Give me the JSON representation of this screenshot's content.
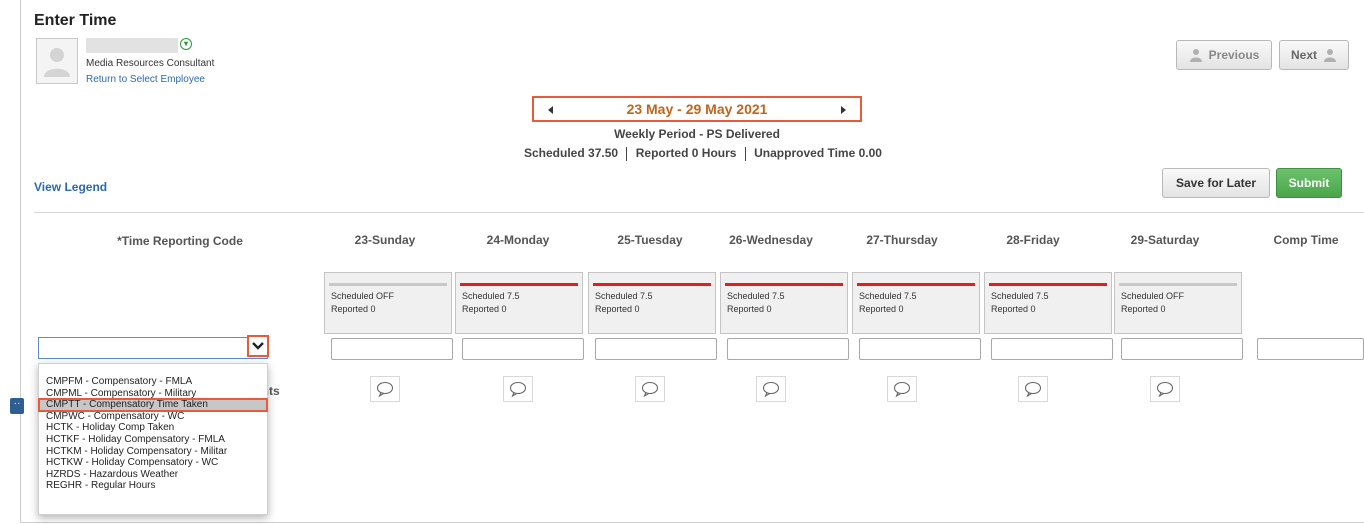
{
  "page": {
    "title": "Enter Time"
  },
  "employee": {
    "role": "Media Resources Consultant",
    "return_link": "Return to Select Employee"
  },
  "nav": {
    "previous_label": "Previous",
    "next_label": "Next"
  },
  "period": {
    "range": "23 May - 29 May 2021",
    "subtitle": "Weekly Period - PS Delivered",
    "scheduled_label": "Scheduled",
    "scheduled_value": "37.50",
    "reported_label": "Reported",
    "reported_value": "0 Hours",
    "unapproved_label": "Unapproved Time",
    "unapproved_value": "0.00"
  },
  "actions": {
    "legend_label": "View Legend",
    "save_label": "Save for Later",
    "submit_label": "Submit"
  },
  "grid": {
    "trc_header": "*Time Reporting Code",
    "comp_time_header": "Comp Time",
    "comments_label_visible": "ents",
    "days": [
      {
        "label": "23-Sunday",
        "scheduled": "Scheduled OFF",
        "reported": "Reported  0",
        "bar_color": "#c8c8c8"
      },
      {
        "label": "24-Monday",
        "scheduled": "Scheduled 7.5",
        "reported": "Reported  0",
        "bar_color": "#e02020"
      },
      {
        "label": "25-Tuesday",
        "scheduled": "Scheduled 7.5",
        "reported": "Reported  0",
        "bar_color": "#e02020"
      },
      {
        "label": "26-Wednesday",
        "scheduled": "Scheduled 7.5",
        "reported": "Reported  0",
        "bar_color": "#e02020"
      },
      {
        "label": "27-Thursday",
        "scheduled": "Scheduled 7.5",
        "reported": "Reported  0",
        "bar_color": "#e02020"
      },
      {
        "label": "28-Friday",
        "scheduled": "Scheduled 7.5",
        "reported": "Reported  0",
        "bar_color": "#e02020"
      },
      {
        "label": "29-Saturday",
        "scheduled": "Scheduled OFF",
        "reported": "Reported  0",
        "bar_color": "#c8c8c8"
      }
    ]
  },
  "trc_dropdown": {
    "selected_value": "",
    "highlighted_index": 2,
    "options": [
      "CMPFM - Compensatory - FMLA",
      "CMPML - Compensatory - Military",
      "CMPTT - Compensatory Time Taken",
      "CMPWC - Compensatory - WC",
      "HCTK - Holiday Comp Taken",
      "HCTKF - Holiday Compensatory - FMLA",
      "HCTKM - Holiday Compensatory - Militar",
      "HCTKW - Holiday Compensatory - WC",
      "HZRDS - Hazardous Weather",
      "REGHR - Regular Hours"
    ]
  },
  "colors": {
    "accent_orange": "#c0651c",
    "highlight_red": "#e85a3a",
    "link_blue": "#2a6ab2",
    "submit_green": "#4aa54a"
  }
}
